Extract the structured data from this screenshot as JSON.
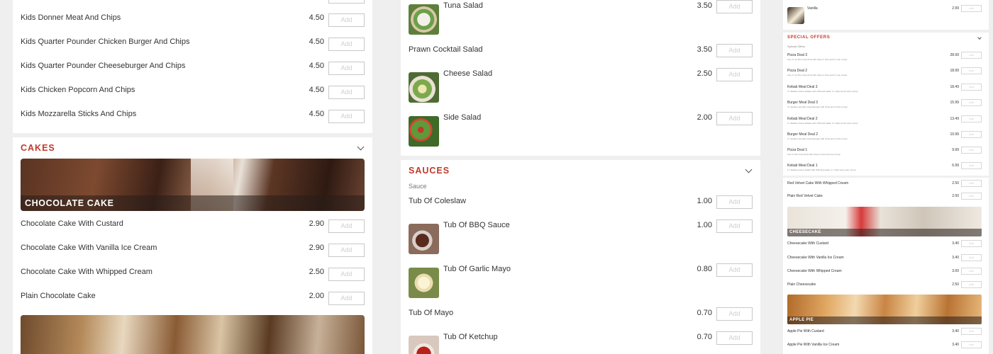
{
  "add_label": "Add",
  "left": {
    "kids_items": [
      {
        "name": "Kids Donner Meat And Chips",
        "price": "4.50"
      },
      {
        "name": "Kids Quarter Pounder Chicken Burger And Chips",
        "price": "4.50"
      },
      {
        "name": "Kids Quarter Pounder Cheeseburger And Chips",
        "price": "4.50"
      },
      {
        "name": "Kids Chicken Popcorn And Chips",
        "price": "4.50"
      },
      {
        "name": "Kids Mozzarella Sticks And Chips",
        "price": "4.50"
      }
    ],
    "cakes_title": "CAKES",
    "cake_banner": "CHOCOLATE CAKE",
    "cake_items": [
      {
        "name": "Chocolate Cake With Custard",
        "price": "2.90"
      },
      {
        "name": "Chocolate Cake With Vanilla Ice Cream",
        "price": "2.90"
      },
      {
        "name": "Chocolate Cake With Whipped Cream",
        "price": "2.50"
      },
      {
        "name": "Plain Chocolate Cake",
        "price": "2.00"
      }
    ]
  },
  "middle": {
    "salad_items": [
      {
        "name": "Tuna Salad",
        "price": "3.50"
      },
      {
        "name": "Prawn Cocktail Salad",
        "price": "3.50"
      },
      {
        "name": "Cheese Salad",
        "price": "2.50"
      },
      {
        "name": "Side Salad",
        "price": "2.00"
      }
    ],
    "sauces_title": "SAUCES",
    "sauces_sub": "Sauce",
    "sauce_items": [
      {
        "name": "Tub Of Coleslaw",
        "price": "1.00"
      },
      {
        "name": "Tub Of BBQ Sauce",
        "price": "1.00"
      },
      {
        "name": "Tub Of Garlic Mayo",
        "price": "0.80"
      },
      {
        "name": "Tub Of Mayo",
        "price": "0.70"
      },
      {
        "name": "Tub Of Ketchup",
        "price": "0.70"
      }
    ]
  },
  "right": {
    "vanilla": {
      "name": "Vanilla",
      "price": "2.99"
    },
    "offers_title": "SPECIAL OFFERS",
    "offers_sub": "Special Offers",
    "offers": [
      {
        "name": "Pizza Deal 3",
        "desc": "Any 3 x 11 thin crust pizza with chips or fries and 3 x can of pop",
        "price": "28.99"
      },
      {
        "name": "Pizza Deal 2",
        "desc": "Any 2 x 11 thin crust pizza with chips or fries and 2 x can of pop",
        "price": "18.99"
      },
      {
        "name": "Kebab Meal Deal 3",
        "desc": "3 x Medium doner kebabs with chilli and salad, 3 x chips and 3 cans of pop",
        "price": "18.49"
      },
      {
        "name": "Burger Meal Deal 3",
        "desc": "3 x Quarter pounder cheeseburger with chips and 3 cans of pop",
        "price": "15.99"
      },
      {
        "name": "Kebab Meal Deal 2",
        "desc": "2 x Medium doner kebabs with chilli and salad, 2 x chips and 2 cans of pop",
        "price": "13.49"
      },
      {
        "name": "Burger Meal Deal 2",
        "desc": "2 x Quarter pounder cheeseburger with chips and 2 cans of pop",
        "price": "10.99"
      },
      {
        "name": "Pizza Deal 1",
        "desc": "Any 11 thin crust pizza with chips or fries and can of pop",
        "price": "9.99"
      },
      {
        "name": "Kebab Meal Deal 1",
        "desc": "1 x Medium doner kebab with chilli and salad, 1 x chips and a can of pop",
        "price": "6.99"
      }
    ],
    "velvet": [
      {
        "name": "Red Velvet Cake With Whipped Cream",
        "price": "2.50"
      },
      {
        "name": "Plain Red Velvet Cake",
        "price": "2.00"
      }
    ],
    "cheesecake_banner": "CHEESECAKE",
    "cheesecake": [
      {
        "name": "Cheesecake With Custard",
        "price": "3.40"
      },
      {
        "name": "Cheesecake With Vanilla Ice Cream",
        "price": "3.40"
      },
      {
        "name": "Cheesecake With Whipped Cream",
        "price": "3.00"
      },
      {
        "name": "Plain Cheesecake",
        "price": "2.50"
      }
    ],
    "applepie_banner": "APPLE PIE",
    "applepie": [
      {
        "name": "Apple Pie With Custard",
        "price": "3.40"
      },
      {
        "name": "Apple Pie With Vanilla Ice Cream",
        "price": "3.40"
      }
    ]
  }
}
